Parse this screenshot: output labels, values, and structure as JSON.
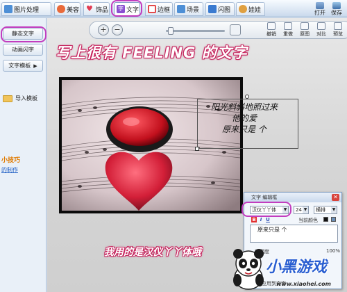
{
  "tabs": [
    {
      "label": "图片处理",
      "icon": "image-edit-icon",
      "color": "#4d8fd6"
    },
    {
      "label": "美容",
      "icon": "face-icon",
      "color": "#e96a3a"
    },
    {
      "label": "饰品",
      "icon": "heart-icon",
      "color": "#e23b52"
    },
    {
      "label": "文字",
      "icon": "text-icon",
      "color": "#8a4fd1"
    },
    {
      "label": "边框",
      "icon": "frame-icon",
      "color": "#e34a4a"
    },
    {
      "label": "场景",
      "icon": "scene-icon",
      "color": "#4d8fd6"
    },
    {
      "label": "闪图",
      "icon": "flash-icon",
      "color": "#3a7ad0"
    },
    {
      "label": "娃娃",
      "icon": "doll-icon",
      "color": "#e0a040"
    }
  ],
  "active_tab": "文字",
  "toolbar_right": {
    "open": "打开",
    "save": "保存"
  },
  "left_panel": {
    "static_text": "静态文字",
    "animated_text": "动画闪字",
    "text_template": "文字模板",
    "import_template": "导入模板",
    "tip_title": "小技巧",
    "tip_link": "的制作"
  },
  "canvas_tools": [
    {
      "label": "撤销",
      "icon": "undo-icon"
    },
    {
      "label": "重做",
      "icon": "redo-icon"
    },
    {
      "label": "原图",
      "icon": "original-icon"
    },
    {
      "label": "对比",
      "icon": "compare-icon"
    },
    {
      "label": "预览",
      "icon": "preview-icon"
    }
  ],
  "zoom": {
    "level": 0.05
  },
  "headline": "写上很有 FEELING 的文字",
  "overlay_text": [
    "阳光斜斜地照过来",
    "他的爱",
    "原来只是 个"
  ],
  "caption": "我用的是汉仪丫丫体哦",
  "editor": {
    "title": "文字 编辑框",
    "font": "汉仪丫丫体",
    "size": "24",
    "layout": "横排",
    "format_bold": "B",
    "format_italic": "I",
    "format_underline": "U",
    "color_label": "当前颜色",
    "text_value": "原来只是 个",
    "opacity_label": "透明度",
    "opacity_value": "100%",
    "apply_label": "应用到文字"
  },
  "colors": {
    "accent_ring": "#c23dbf",
    "headline_stroke": "#c6265f",
    "watermark_blue": "#2a5fd1"
  },
  "watermark": {
    "text": "小黑游戏",
    "url": "www.xiaohei.com"
  }
}
